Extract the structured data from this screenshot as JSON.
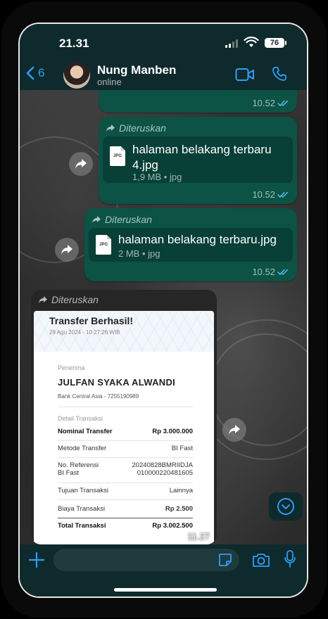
{
  "status_bar": {
    "time": "21.31",
    "battery": "76"
  },
  "header": {
    "back_count": "6",
    "contact_name": "Nung Manben",
    "contact_status": "online"
  },
  "messages": [
    {
      "type": "continued",
      "time": "10.52"
    },
    {
      "type": "file",
      "forward_label": "Diteruskan",
      "icon_text": "JPG",
      "file_name": "halaman belakang terbaru 4.jpg",
      "file_meta": "1,9 MB • jpg",
      "time": "10.52"
    },
    {
      "type": "file",
      "forward_label": "Diteruskan",
      "icon_text": "JPG",
      "file_name": "halaman belakang terbaru.jpg",
      "file_meta": "2 MB • jpg",
      "time": "10.52"
    },
    {
      "type": "image",
      "forward_label": "Diteruskan",
      "time": "11.27",
      "receipt": {
        "title": "Transfer Berhasil!",
        "date": "28 Agu 2024 - 10:27:26 WIB",
        "recipient_label": "Penerima",
        "recipient_name": "JULFAN SYAKA ALWANDI",
        "bank": "Bank Central Asia - 7255190989",
        "details_label": "Detail Transaksi",
        "rows": [
          {
            "label": "Nominal Transfer",
            "value": "Rp 3.000.000"
          },
          {
            "label": "Metode Transfer",
            "value": "BI Fast"
          },
          {
            "label": "No. Referensi",
            "label2": "BI Fast",
            "value": "20240828BMRIIDJA",
            "value2": "010000220481605"
          },
          {
            "label": "Tujuan Transaksi",
            "value": "Lainnya"
          },
          {
            "label": "Biaya Transaksi",
            "value": "Rp 2.500"
          },
          {
            "label": "Total Transaksi",
            "value": "Rp 3.002.500"
          }
        ]
      }
    }
  ],
  "input": {
    "placeholder": ""
  },
  "colors": {
    "accent": "#2f9df6",
    "bubble": "#0c5245",
    "header": "#0f2a2d"
  },
  "icons": [
    "back-chevron-icon",
    "video-call-icon",
    "phone-icon",
    "forward-icon",
    "share-icon",
    "double-check-icon",
    "chevron-down-icon",
    "plus-icon",
    "sticker-icon",
    "camera-icon",
    "mic-icon"
  ]
}
